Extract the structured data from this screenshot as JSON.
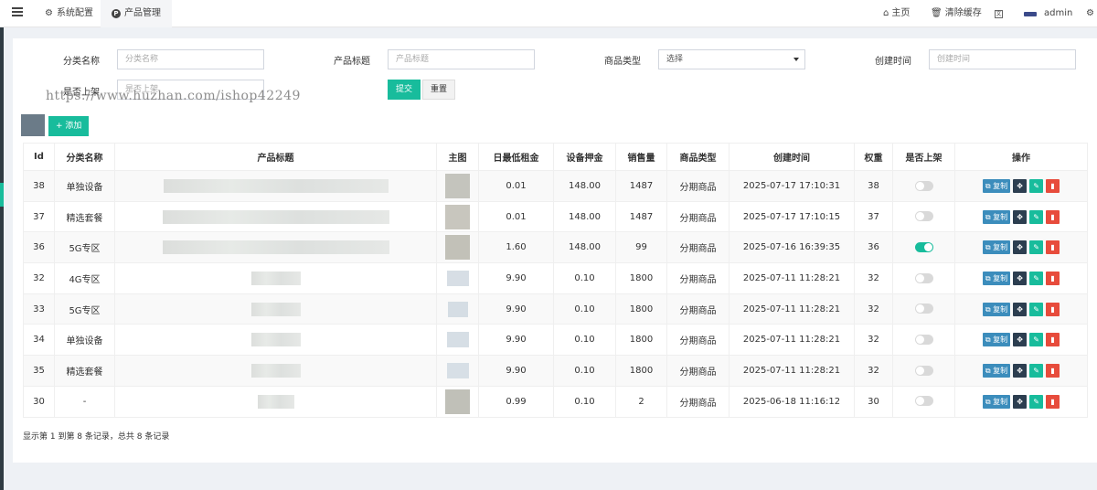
{
  "topbar": {
    "tabs": [
      {
        "label": "系统配置",
        "icon": "gear-icon"
      },
      {
        "label": "产品管理",
        "icon": "p-circle-icon"
      }
    ],
    "right": {
      "home": "主页",
      "clear_cache": "清除缓存",
      "user": "admin"
    }
  },
  "filters": {
    "category": {
      "label": "分类名称",
      "placeholder": "分类名称"
    },
    "title": {
      "label": "产品标题",
      "placeholder": "产品标题"
    },
    "type": {
      "label": "商品类型",
      "value": "选择"
    },
    "created": {
      "label": "创建时间",
      "placeholder": "创建时间"
    },
    "listed": {
      "label": "是否上架",
      "placeholder": "是否上架"
    },
    "submit": "提交",
    "reset": "重置"
  },
  "watermark": "https://www.huzhan.com/ishop42249",
  "toolbar": {
    "add": "+ 添加"
  },
  "table": {
    "columns": [
      "Id",
      "分类名称",
      "产品标题",
      "主图",
      "日最低租金",
      "设备押金",
      "销售量",
      "商品类型",
      "创建时间",
      "权重",
      "是否上架",
      "操作"
    ],
    "rows": [
      {
        "id": "38",
        "category": "单独设备",
        "rent": "0.01",
        "deposit": "148.00",
        "sales": "1487",
        "type": "分期商品",
        "created": "2025-07-17 17:10:31",
        "weight": "38",
        "listed": false
      },
      {
        "id": "37",
        "category": "精选套餐",
        "rent": "0.01",
        "deposit": "148.00",
        "sales": "1487",
        "type": "分期商品",
        "created": "2025-07-17 17:10:15",
        "weight": "37",
        "listed": false
      },
      {
        "id": "36",
        "category": "5G专区",
        "rent": "1.60",
        "deposit": "148.00",
        "sales": "99",
        "type": "分期商品",
        "created": "2025-07-16 16:39:35",
        "weight": "36",
        "listed": true
      },
      {
        "id": "32",
        "category": "4G专区",
        "rent": "9.90",
        "deposit": "0.10",
        "sales": "1800",
        "type": "分期商品",
        "created": "2025-07-11 11:28:21",
        "weight": "32",
        "listed": false
      },
      {
        "id": "33",
        "category": "5G专区",
        "rent": "9.90",
        "deposit": "0.10",
        "sales": "1800",
        "type": "分期商品",
        "created": "2025-07-11 11:28:21",
        "weight": "32",
        "listed": false
      },
      {
        "id": "34",
        "category": "单独设备",
        "rent": "9.90",
        "deposit": "0.10",
        "sales": "1800",
        "type": "分期商品",
        "created": "2025-07-11 11:28:21",
        "weight": "32",
        "listed": false
      },
      {
        "id": "35",
        "category": "精选套餐",
        "rent": "9.90",
        "deposit": "0.10",
        "sales": "1800",
        "type": "分期商品",
        "created": "2025-07-11 11:28:21",
        "weight": "32",
        "listed": false
      },
      {
        "id": "30",
        "category": "-",
        "rent": "0.99",
        "deposit": "0.10",
        "sales": "2",
        "type": "分期商品",
        "created": "2025-06-18 11:16:12",
        "weight": "30",
        "listed": false
      }
    ],
    "copy_label": "复制"
  },
  "pagination_info": "显示第 1 到第 8 条记录，总共 8 条记录",
  "colors": {
    "accent": "#18bc9c",
    "primary": "#3c8dbc",
    "danger": "#e74c3c",
    "dark": "#2c3e50"
  }
}
